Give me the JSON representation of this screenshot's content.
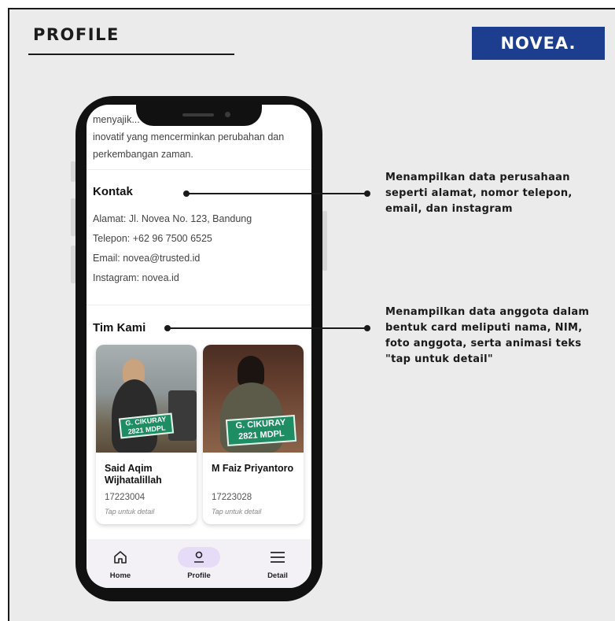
{
  "header": {
    "title": "PROFILE",
    "logo_text": "NOVEA."
  },
  "screen": {
    "about_lines": [
      "menyajik... ..., dan",
      "inovatif yang mencerminkan perubahan dan",
      "perkembangan zaman."
    ],
    "contact": {
      "title": "Kontak",
      "address": "Alamat: Jl. Novea No. 123, Bandung",
      "phone": "Telepon: +62 96 7500 6525",
      "email": "Email: novea@trusted.id",
      "instagram": "Instagram: novea.id"
    },
    "team": {
      "title": "Tim Kami",
      "members": [
        {
          "name": "Said Aqim Wijhatalillah",
          "nim": "17223004",
          "tap": "Tap untuk detail",
          "sign_line1": "G. CIKURAY",
          "sign_line2": "2821 MDPL"
        },
        {
          "name": "M Faiz Priyantoro",
          "nim": "17223028",
          "tap": "Tap untuk detail",
          "sign_line1": "G. CIKURAY",
          "sign_line2": "2821 MDPL"
        }
      ]
    },
    "nav": [
      {
        "label": "Home",
        "icon": "home-icon"
      },
      {
        "label": "Profile",
        "icon": "person-icon"
      },
      {
        "label": "Detail",
        "icon": "menu-icon"
      }
    ]
  },
  "callouts": {
    "contact": "Menampilkan data perusahaan seperti alamat, nomor telepon, email, dan instagram",
    "team": "Menampilkan data anggota dalam bentuk card meliputi nama, NIM, foto anggota, serta animasi teks \"tap untuk detail\""
  },
  "colors": {
    "logo_bg": "#1d3e8f",
    "nav_active_pill": "#e6dcf7",
    "sign_green": "#1f8d63"
  }
}
